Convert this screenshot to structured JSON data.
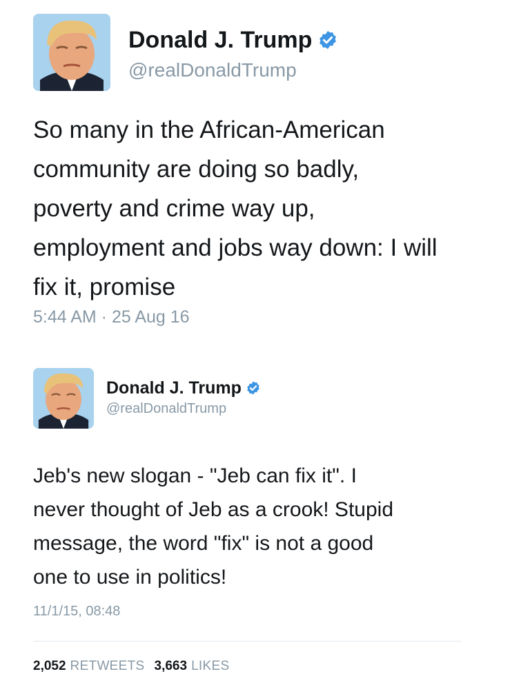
{
  "tweet1": {
    "display_name": "Donald J. Trump",
    "handle": "@realDonaldTrump",
    "text_lines": [
      "So many in the African-American",
      "community are doing so badly,",
      "poverty and crime way up,",
      "employment and jobs way down: I will",
      "fix it, promise"
    ],
    "timestamp": "5:44 AM · 25 Aug 16"
  },
  "tweet2": {
    "display_name": "Donald J. Trump",
    "handle": "@realDonaldTrump",
    "text_lines": [
      "Jeb's new slogan - \"Jeb can fix it\". I",
      "never thought of Jeb as a crook! Stupid",
      "message, the word \"fix\" is not a good",
      "one to use in politics!"
    ],
    "timestamp": "11/1/15, 08:48",
    "retweets_count": "2,052",
    "retweets_label": "RETWEETS",
    "likes_count": "3,663",
    "likes_label": "LIKES"
  },
  "icons": {
    "verified": "verified-badge-icon",
    "avatar": "profile-photo"
  },
  "colors": {
    "text": "#14171a",
    "secondary": "#8899a6",
    "verified_blue": "#3d95e3",
    "divider": "#e1e8ed"
  }
}
